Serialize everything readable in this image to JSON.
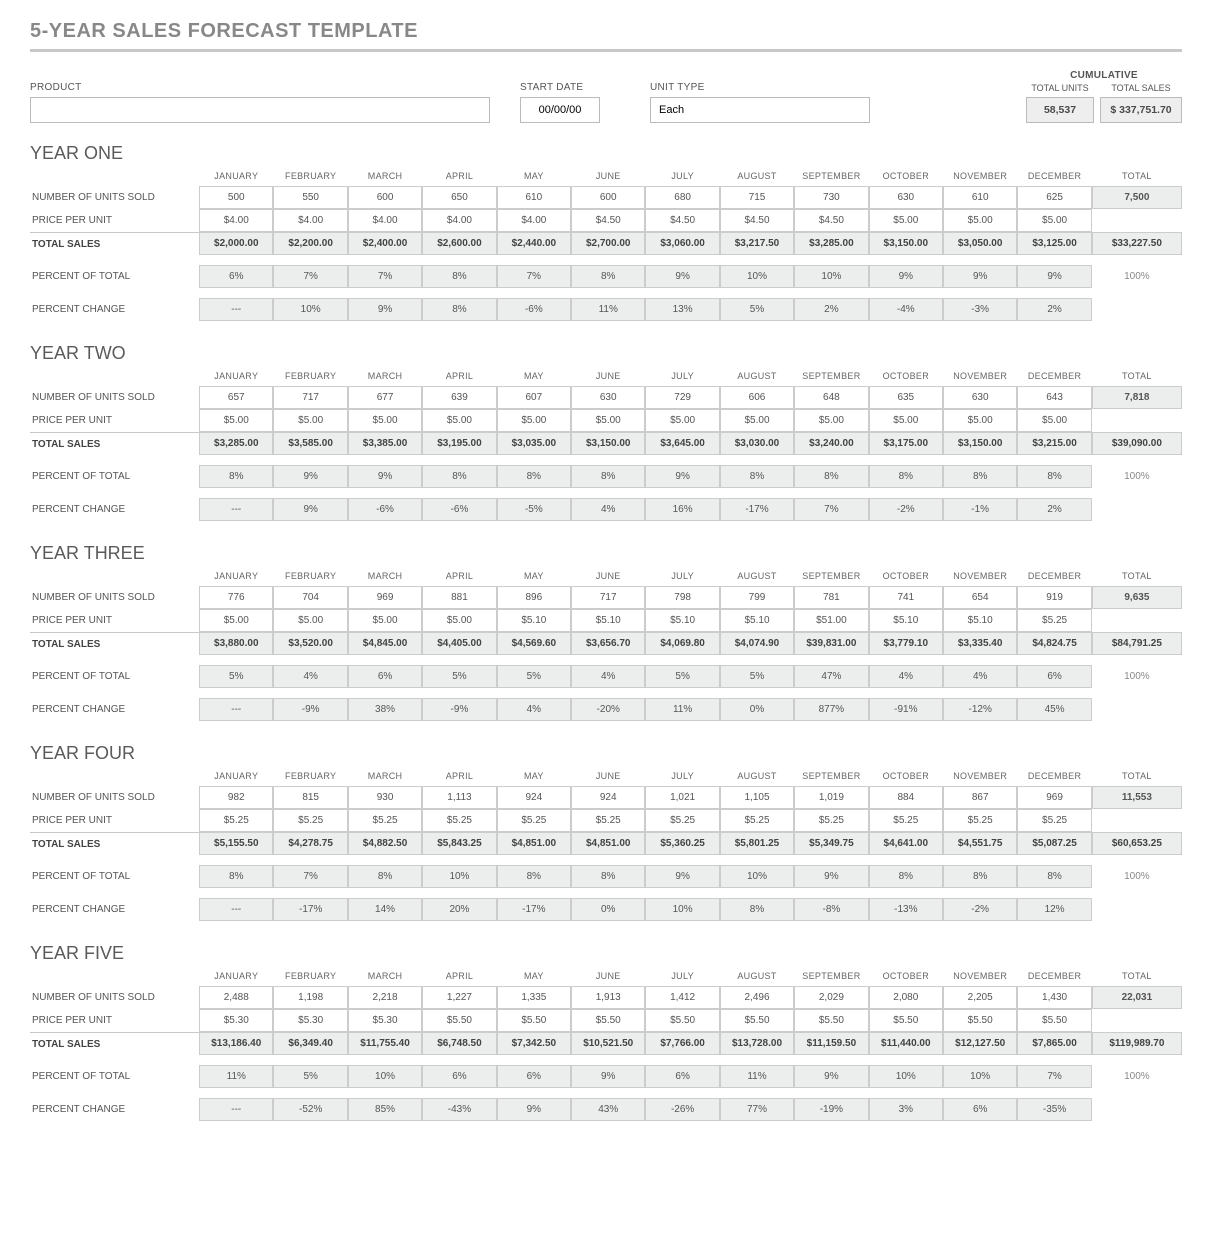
{
  "title": "5-YEAR SALES FORECAST TEMPLATE",
  "header": {
    "product_label": "PRODUCT",
    "product_value": "",
    "start_date_label": "START DATE",
    "start_date_value": "00/00/00",
    "unit_type_label": "UNIT TYPE",
    "unit_type_value": "Each",
    "cumulative_label": "CUMULATIVE",
    "total_units_label": "TOTAL UNITS",
    "total_units_value": "58,537",
    "total_sales_label": "TOTAL SALES",
    "total_sales_value": "$ 337,751.70"
  },
  "months": [
    "JANUARY",
    "FEBRUARY",
    "MARCH",
    "APRIL",
    "MAY",
    "JUNE",
    "JULY",
    "AUGUST",
    "SEPTEMBER",
    "OCTOBER",
    "NOVEMBER",
    "DECEMBER"
  ],
  "total_label": "TOTAL",
  "row_labels": {
    "units": "NUMBER OF UNITS SOLD",
    "price": "PRICE PER UNIT",
    "sales": "TOTAL SALES",
    "pct_total": "PERCENT OF TOTAL",
    "pct_change": "PERCENT CHANGE"
  },
  "years": [
    {
      "title": "YEAR ONE",
      "units": [
        "500",
        "550",
        "600",
        "650",
        "610",
        "600",
        "680",
        "715",
        "730",
        "630",
        "610",
        "625"
      ],
      "units_total": "7,500",
      "price": [
        "$4.00",
        "$4.00",
        "$4.00",
        "$4.00",
        "$4.00",
        "$4.50",
        "$4.50",
        "$4.50",
        "$4.50",
        "$5.00",
        "$5.00",
        "$5.00"
      ],
      "price_total": "",
      "sales": [
        "$2,000.00",
        "$2,200.00",
        "$2,400.00",
        "$2,600.00",
        "$2,440.00",
        "$2,700.00",
        "$3,060.00",
        "$3,217.50",
        "$3,285.00",
        "$3,150.00",
        "$3,050.00",
        "$3,125.00"
      ],
      "sales_total": "$33,227.50",
      "pct_total": [
        "6%",
        "7%",
        "7%",
        "8%",
        "7%",
        "8%",
        "9%",
        "10%",
        "10%",
        "9%",
        "9%",
        "9%"
      ],
      "pct_total_total": "100%",
      "pct_change": [
        "---",
        "10%",
        "9%",
        "8%",
        "-6%",
        "11%",
        "13%",
        "5%",
        "2%",
        "-4%",
        "-3%",
        "2%"
      ],
      "pct_change_total": ""
    },
    {
      "title": "YEAR TWO",
      "units": [
        "657",
        "717",
        "677",
        "639",
        "607",
        "630",
        "729",
        "606",
        "648",
        "635",
        "630",
        "643"
      ],
      "units_total": "7,818",
      "price": [
        "$5.00",
        "$5.00",
        "$5.00",
        "$5.00",
        "$5.00",
        "$5.00",
        "$5.00",
        "$5.00",
        "$5.00",
        "$5.00",
        "$5.00",
        "$5.00"
      ],
      "price_total": "",
      "sales": [
        "$3,285.00",
        "$3,585.00",
        "$3,385.00",
        "$3,195.00",
        "$3,035.00",
        "$3,150.00",
        "$3,645.00",
        "$3,030.00",
        "$3,240.00",
        "$3,175.00",
        "$3,150.00",
        "$3,215.00"
      ],
      "sales_total": "$39,090.00",
      "pct_total": [
        "8%",
        "9%",
        "9%",
        "8%",
        "8%",
        "8%",
        "9%",
        "8%",
        "8%",
        "8%",
        "8%",
        "8%"
      ],
      "pct_total_total": "100%",
      "pct_change": [
        "---",
        "9%",
        "-6%",
        "-6%",
        "-5%",
        "4%",
        "16%",
        "-17%",
        "7%",
        "-2%",
        "-1%",
        "2%"
      ],
      "pct_change_total": ""
    },
    {
      "title": "YEAR THREE",
      "units": [
        "776",
        "704",
        "969",
        "881",
        "896",
        "717",
        "798",
        "799",
        "781",
        "741",
        "654",
        "919"
      ],
      "units_total": "9,635",
      "price": [
        "$5.00",
        "$5.00",
        "$5.00",
        "$5.00",
        "$5.10",
        "$5.10",
        "$5.10",
        "$5.10",
        "$51.00",
        "$5.10",
        "$5.10",
        "$5.25"
      ],
      "price_total": "",
      "sales": [
        "$3,880.00",
        "$3,520.00",
        "$4,845.00",
        "$4,405.00",
        "$4,569.60",
        "$3,656.70",
        "$4,069.80",
        "$4,074.90",
        "$39,831.00",
        "$3,779.10",
        "$3,335.40",
        "$4,824.75"
      ],
      "sales_total": "$84,791.25",
      "pct_total": [
        "5%",
        "4%",
        "6%",
        "5%",
        "5%",
        "4%",
        "5%",
        "5%",
        "47%",
        "4%",
        "4%",
        "6%"
      ],
      "pct_total_total": "100%",
      "pct_change": [
        "---",
        "-9%",
        "38%",
        "-9%",
        "4%",
        "-20%",
        "11%",
        "0%",
        "877%",
        "-91%",
        "-12%",
        "45%"
      ],
      "pct_change_total": ""
    },
    {
      "title": "YEAR FOUR",
      "units": [
        "982",
        "815",
        "930",
        "1,113",
        "924",
        "924",
        "1,021",
        "1,105",
        "1,019",
        "884",
        "867",
        "969"
      ],
      "units_total": "11,553",
      "price": [
        "$5.25",
        "$5.25",
        "$5.25",
        "$5.25",
        "$5.25",
        "$5.25",
        "$5.25",
        "$5.25",
        "$5.25",
        "$5.25",
        "$5.25",
        "$5.25"
      ],
      "price_total": "",
      "sales": [
        "$5,155.50",
        "$4,278.75",
        "$4,882.50",
        "$5,843.25",
        "$4,851.00",
        "$4,851.00",
        "$5,360.25",
        "$5,801.25",
        "$5,349.75",
        "$4,641.00",
        "$4,551.75",
        "$5,087.25"
      ],
      "sales_total": "$60,653.25",
      "pct_total": [
        "8%",
        "7%",
        "8%",
        "10%",
        "8%",
        "8%",
        "9%",
        "10%",
        "9%",
        "8%",
        "8%",
        "8%"
      ],
      "pct_total_total": "100%",
      "pct_change": [
        "---",
        "-17%",
        "14%",
        "20%",
        "-17%",
        "0%",
        "10%",
        "8%",
        "-8%",
        "-13%",
        "-2%",
        "12%"
      ],
      "pct_change_total": ""
    },
    {
      "title": "YEAR FIVE",
      "units": [
        "2,488",
        "1,198",
        "2,218",
        "1,227",
        "1,335",
        "1,913",
        "1,412",
        "2,496",
        "2,029",
        "2,080",
        "2,205",
        "1,430"
      ],
      "units_total": "22,031",
      "price": [
        "$5.30",
        "$5.30",
        "$5.30",
        "$5.50",
        "$5.50",
        "$5.50",
        "$5.50",
        "$5.50",
        "$5.50",
        "$5.50",
        "$5.50",
        "$5.50"
      ],
      "price_total": "",
      "sales": [
        "$13,186.40",
        "$6,349.40",
        "$11,755.40",
        "$6,748.50",
        "$7,342.50",
        "$10,521.50",
        "$7,766.00",
        "$13,728.00",
        "$11,159.50",
        "$11,440.00",
        "$12,127.50",
        "$7,865.00"
      ],
      "sales_total": "$119,989.70",
      "pct_total": [
        "11%",
        "5%",
        "10%",
        "6%",
        "6%",
        "9%",
        "6%",
        "11%",
        "9%",
        "10%",
        "10%",
        "7%"
      ],
      "pct_total_total": "100%",
      "pct_change": [
        "---",
        "-52%",
        "85%",
        "-43%",
        "9%",
        "43%",
        "-26%",
        "77%",
        "-19%",
        "3%",
        "6%",
        "-35%"
      ],
      "pct_change_total": ""
    }
  ]
}
